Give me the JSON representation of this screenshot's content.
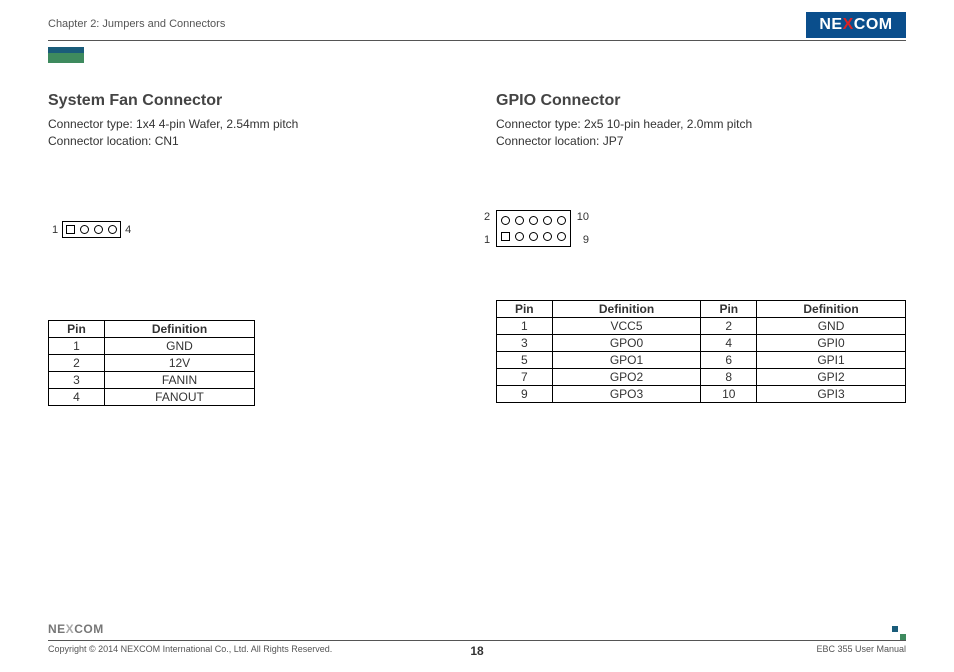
{
  "header": {
    "chapter": "Chapter 2: Jumpers and Connectors",
    "logo": "NEXCOM"
  },
  "left": {
    "title": "System Fan Connector",
    "type_line": "Connector type: 1x4 4-pin Wafer, 2.54mm pitch",
    "loc_line": "Connector location: CN1",
    "diag": {
      "left_label": "1",
      "right_label": "4"
    },
    "table": {
      "headers": [
        "Pin",
        "Definition"
      ],
      "rows": [
        [
          "1",
          "GND"
        ],
        [
          "2",
          "12V"
        ],
        [
          "3",
          "FANIN"
        ],
        [
          "4",
          "FANOUT"
        ]
      ]
    }
  },
  "right": {
    "title": "GPIO Connector",
    "type_line": "Connector type: 2x5 10-pin header, 2.0mm pitch",
    "loc_line": "Connector location: JP7",
    "diag": {
      "tl": "2",
      "tr": "10",
      "bl": "1",
      "br": "9"
    },
    "table": {
      "headers": [
        "Pin",
        "Definition",
        "Pin",
        "Definition"
      ],
      "rows": [
        [
          "1",
          "VCC5",
          "2",
          "GND"
        ],
        [
          "3",
          "GPO0",
          "4",
          "GPI0"
        ],
        [
          "5",
          "GPO1",
          "6",
          "GPI1"
        ],
        [
          "7",
          "GPO2",
          "8",
          "GPI2"
        ],
        [
          "9",
          "GPO3",
          "10",
          "GPI3"
        ]
      ]
    }
  },
  "footer": {
    "logo": "NEXCOM",
    "copyright": "Copyright © 2014 NEXCOM International Co., Ltd. All Rights Reserved.",
    "page": "18",
    "doc": "EBC 355 User Manual"
  }
}
